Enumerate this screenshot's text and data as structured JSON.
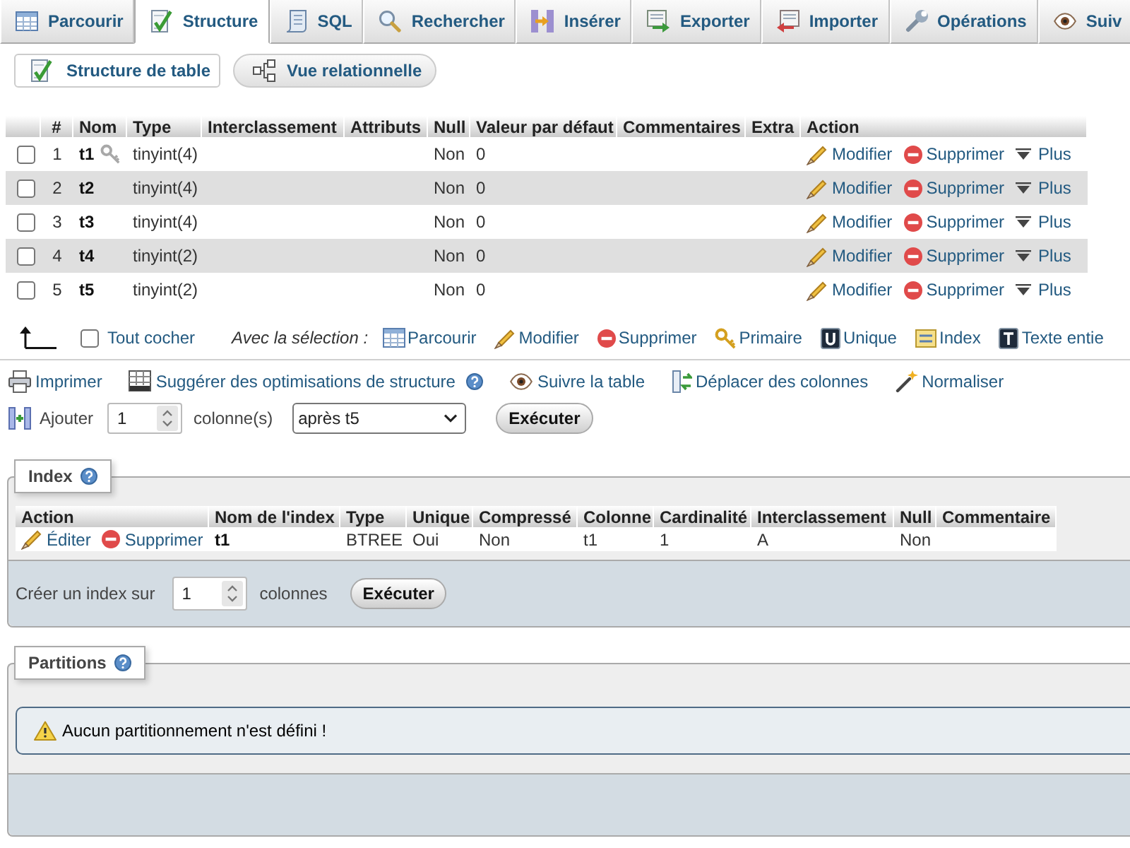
{
  "tabs": [
    {
      "label": "Parcourir",
      "kind": "browse",
      "selected": false
    },
    {
      "label": "Structure",
      "kind": "structure",
      "selected": true
    },
    {
      "label": "SQL",
      "kind": "sql",
      "selected": false
    },
    {
      "label": "Rechercher",
      "kind": "search",
      "selected": false
    },
    {
      "label": "Insérer",
      "kind": "insert",
      "selected": false
    },
    {
      "label": "Exporter",
      "kind": "export",
      "selected": false
    },
    {
      "label": "Importer",
      "kind": "import",
      "selected": false
    },
    {
      "label": "Opérations",
      "kind": "operations",
      "selected": false
    },
    {
      "label": "Suiv",
      "kind": "tracking",
      "selected": false
    }
  ],
  "subtabs": [
    {
      "label": "Structure de table",
      "kind": "structure",
      "selected": true
    },
    {
      "label": "Vue relationnelle",
      "kind": "relation",
      "selected": false
    }
  ],
  "structure_table": {
    "columns": [
      "#",
      "Nom",
      "Type",
      "Interclassement",
      "Attributs",
      "Null",
      "Valeur par défaut",
      "Commentaires",
      "Extra",
      "Action"
    ],
    "rows": [
      {
        "checked": false,
        "number": "1",
        "name": "t1",
        "primary_key": true,
        "type": "tinyint(4)",
        "null": "Non",
        "default": "0",
        "actions": [
          {
            "kind": "edit",
            "label": "Modifier"
          },
          {
            "kind": "drop",
            "label": "Supprimer"
          },
          {
            "kind": "more",
            "label": "Plus"
          }
        ]
      },
      {
        "checked": false,
        "number": "2",
        "name": "t2",
        "primary_key": false,
        "type": "tinyint(4)",
        "null": "Non",
        "default": "0",
        "actions": [
          {
            "kind": "edit",
            "label": "Modifier"
          },
          {
            "kind": "drop",
            "label": "Supprimer"
          },
          {
            "kind": "more",
            "label": "Plus"
          }
        ]
      },
      {
        "checked": false,
        "number": "3",
        "name": "t3",
        "primary_key": false,
        "type": "tinyint(4)",
        "null": "Non",
        "default": "0",
        "actions": [
          {
            "kind": "edit",
            "label": "Modifier"
          },
          {
            "kind": "drop",
            "label": "Supprimer"
          },
          {
            "kind": "more",
            "label": "Plus"
          }
        ]
      },
      {
        "checked": false,
        "number": "4",
        "name": "t4",
        "primary_key": false,
        "type": "tinyint(2)",
        "null": "Non",
        "default": "0",
        "actions": [
          {
            "kind": "edit",
            "label": "Modifier"
          },
          {
            "kind": "drop",
            "label": "Supprimer"
          },
          {
            "kind": "more",
            "label": "Plus"
          }
        ]
      },
      {
        "checked": false,
        "number": "5",
        "name": "t5",
        "primary_key": false,
        "type": "tinyint(2)",
        "null": "Non",
        "default": "0",
        "actions": [
          {
            "kind": "edit",
            "label": "Modifier"
          },
          {
            "kind": "drop",
            "label": "Supprimer"
          },
          {
            "kind": "more",
            "label": "Plus"
          }
        ]
      }
    ]
  },
  "selection_bar": {
    "check_all": {
      "label": "Tout cocher",
      "checked": false
    },
    "label": "Avec la sélection :",
    "actions": [
      {
        "kind": "browse",
        "label": "Parcourir"
      },
      {
        "kind": "edit",
        "label": "Modifier"
      },
      {
        "kind": "drop",
        "label": "Supprimer"
      },
      {
        "kind": "primary",
        "label": "Primaire"
      },
      {
        "kind": "unique",
        "label": "Unique"
      },
      {
        "kind": "index",
        "label": "Index"
      },
      {
        "kind": "fulltext",
        "label": "Texte entie"
      }
    ]
  },
  "table_links": [
    {
      "kind": "print",
      "label": "Imprimer",
      "help": false
    },
    {
      "kind": "propose",
      "label": "Suggérer des optimisations de structure",
      "help": true
    },
    {
      "kind": "track",
      "label": "Suivre la table",
      "help": false
    },
    {
      "kind": "move",
      "label": "Déplacer des colonnes",
      "help": false
    },
    {
      "kind": "normalize",
      "label": "Normaliser",
      "help": false
    }
  ],
  "add_columns": {
    "label": "Ajouter",
    "count": "1",
    "unit": "colonne(s)",
    "position": "après t5",
    "button": "Exécuter"
  },
  "indexes": {
    "title": "Index",
    "columns": [
      "Action",
      "Nom de l'index",
      "Type",
      "Unique",
      "Compressé",
      "Colonne",
      "Cardinalité",
      "Interclassement",
      "Null",
      "Commentaire"
    ],
    "rows": [
      {
        "actions": [
          {
            "kind": "edit",
            "label": "Éditer"
          },
          {
            "kind": "drop",
            "label": "Supprimer"
          }
        ],
        "name": "t1",
        "type": "BTREE",
        "unique": "Oui",
        "packed": "Non",
        "column": "t1",
        "cardinality": "1",
        "collation": "A",
        "null": "Non"
      }
    ],
    "create": {
      "label": "Créer un index sur",
      "count": "1",
      "unit": "colonnes",
      "button": "Exécuter"
    }
  },
  "partitions": {
    "title": "Partitions",
    "message": "Aucun partitionnement n'est défini !"
  }
}
